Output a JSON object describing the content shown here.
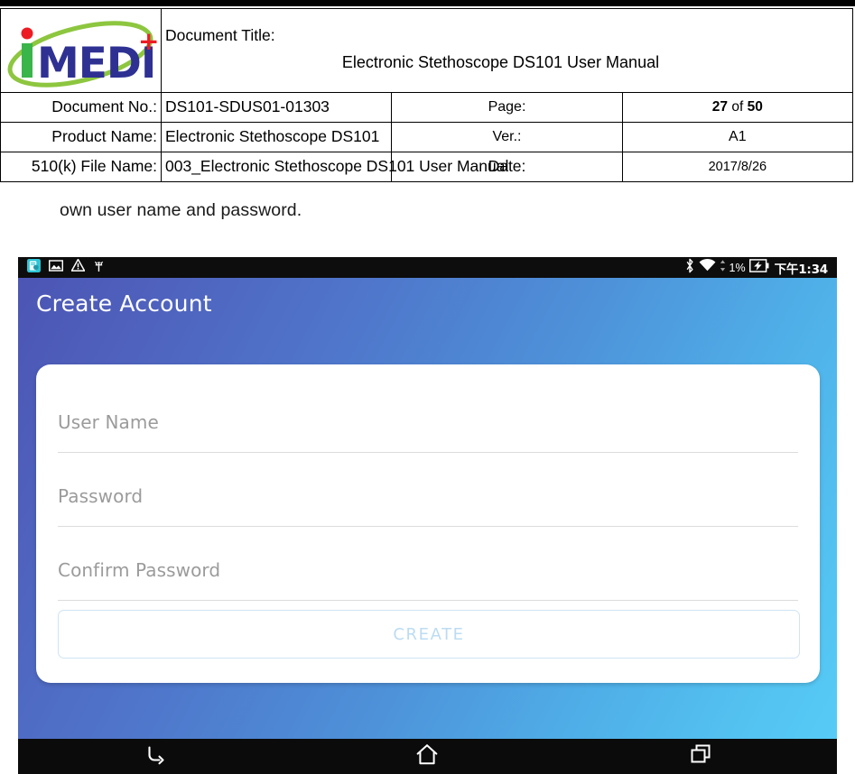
{
  "document_header": {
    "logo": {
      "name": "imedi-logo",
      "text_i": "i",
      "text_medi": "MEDI",
      "text_plus": "+",
      "color_green": "#6CBE2A",
      "color_blue": "#2E3192",
      "color_red": "#ED1C24"
    },
    "title_label": "Document Title:",
    "title_value": "Electronic Stethoscope DS101 User Manual",
    "rows": [
      {
        "label": "Document No.:",
        "value": "DS101-SDUS01-01303",
        "right_label": "Page:",
        "right_value_prefix": "27",
        "right_value_middle": "of",
        "right_value_suffix": "50"
      },
      {
        "label": "Product Name:",
        "value": "Electronic Stethoscope DS101",
        "right_label": "Ver.:",
        "right_value": "A1"
      },
      {
        "label": "510(k) File Name:",
        "value": "003_Electronic Stethoscope DS101 User Manual",
        "right_label": "Date:",
        "right_value": "2017/8/26"
      }
    ]
  },
  "body": {
    "paragraph": "own user name and password."
  },
  "android_screenshot": {
    "status_bar": {
      "notification_icons": [
        "app-document-icon",
        "screenshot-image-icon",
        "warning-triangle-icon",
        "adb-bug-icon"
      ],
      "bluetooth_icon": "bluetooth-icon",
      "wifi_icon": "wifi-icon",
      "data-transfer-icon": "data-transfer-arrows-icon",
      "battery_percent": "1%",
      "battery_icon": "battery-charging-icon",
      "clock": "下午1:34"
    },
    "app": {
      "title": "Create Account",
      "gradient_start": "#4C55B4",
      "gradient_end": "#57CBF6",
      "card": {
        "fields": [
          {
            "placeholder": "User Name"
          },
          {
            "placeholder": "Password"
          },
          {
            "placeholder": "Confirm Password"
          }
        ],
        "create_button": {
          "label": "CREATE",
          "text_color": "#BCDCF2",
          "border_color": "#CFE4F3"
        }
      }
    },
    "nav_bar": {
      "buttons": [
        {
          "name": "back-icon"
        },
        {
          "name": "home-icon"
        },
        {
          "name": "recents-icon"
        }
      ]
    }
  }
}
